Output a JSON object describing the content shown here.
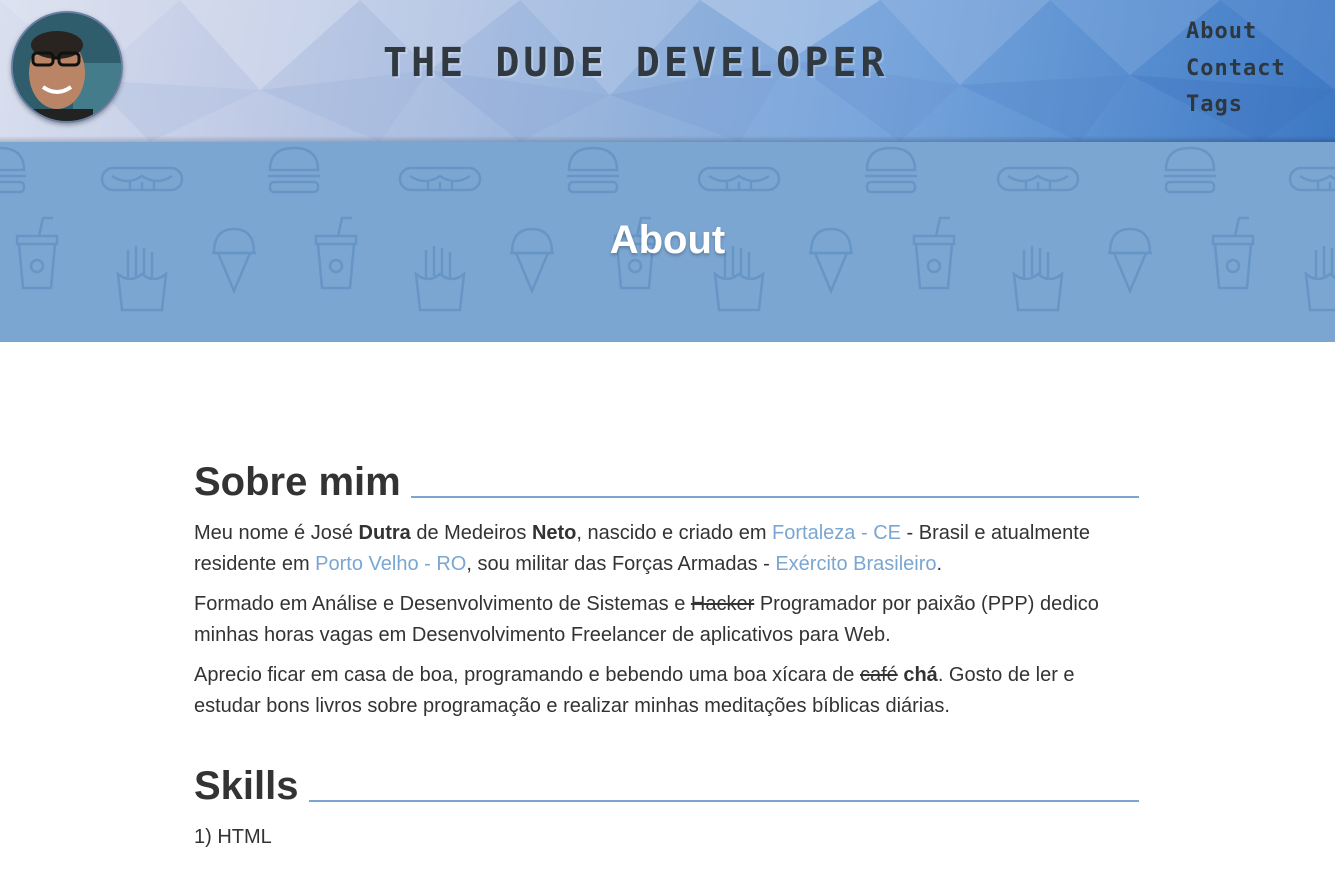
{
  "site": {
    "title": "THE DUDE DEVELOPER",
    "nav": [
      "About",
      "Contact",
      "Tags"
    ]
  },
  "banner": {
    "heading": "About"
  },
  "about": {
    "heading": "Sobre mim",
    "p1": {
      "t1": "Meu nome é José ",
      "b1": "Dutra",
      "t2": " de Medeiros ",
      "b2": "Neto",
      "t3": ", nascido e criado em ",
      "link1": "Fortaleza - CE",
      "t4": " - Brasil e atualmente residente em ",
      "link2": "Porto Velho - RO",
      "t5": ", sou militar das Forças Armadas - ",
      "link3": "Exército Brasileiro",
      "t6": "."
    },
    "p2": {
      "t1": "Formado em Análise e Desenvolvimento de Sistemas e ",
      "strike": "Hacker",
      "t2": " Programador por paixão (PPP) dedico minhas horas vagas em Desenvolvimento Freelancer de aplicativos para Web."
    },
    "p3": {
      "t1": "Aprecio ficar em casa de boa, programando e bebendo uma boa xícara de ",
      "strike": "café",
      "t2": " ",
      "bold": "chá",
      "t3": ". Gosto de ler e estudar bons livros sobre programação e realizar minhas meditações bíblicas diárias."
    }
  },
  "skills": {
    "heading": "Skills",
    "items": [
      "1) HTML"
    ]
  },
  "colors": {
    "accent": "#7ba6d1",
    "text": "#333333",
    "banner": "#7ba6d1"
  },
  "icons": [
    "avatar-photo",
    "hamburger-icon",
    "hotdog-icon",
    "soda-cup-icon",
    "ice-cream-icon",
    "fries-icon"
  ]
}
